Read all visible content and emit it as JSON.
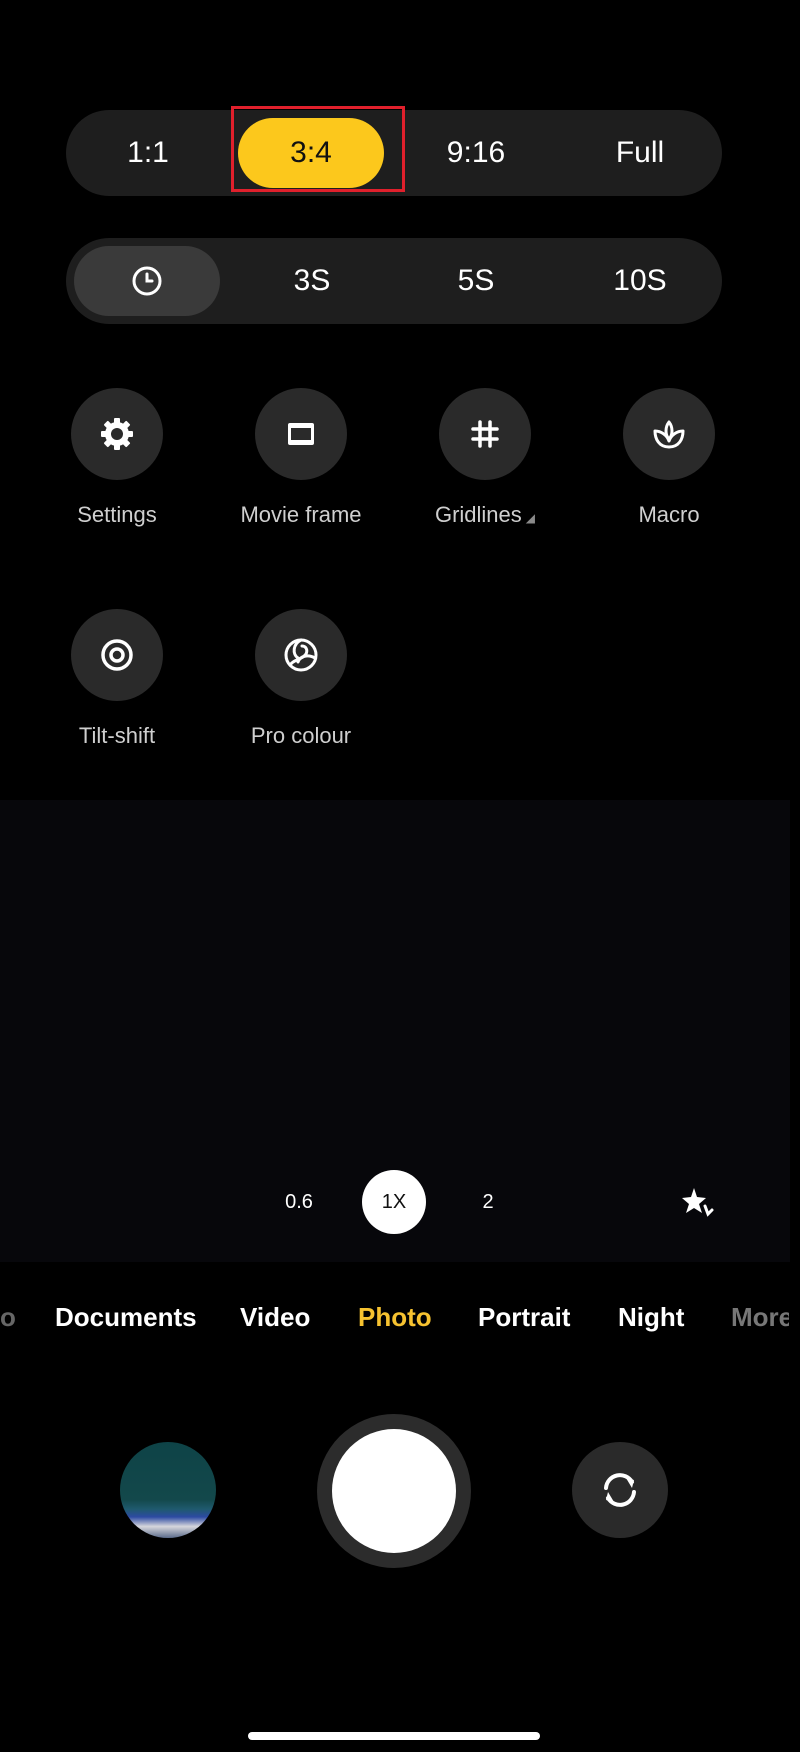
{
  "aspect_ratio": {
    "options": [
      "1:1",
      "3:4",
      "9:16",
      "Full"
    ],
    "selected": "3:4"
  },
  "timer": {
    "options": [
      "clock-icon",
      "3S",
      "5S",
      "10S"
    ],
    "labels": {
      "three": "3S",
      "five": "5S",
      "ten": "10S"
    },
    "selected": "off"
  },
  "tools": [
    {
      "label": "Settings",
      "icon": "gear-icon"
    },
    {
      "label": "Movie frame",
      "icon": "movie-frame-icon"
    },
    {
      "label": "Gridlines",
      "icon": "grid-icon"
    },
    {
      "label": "Macro",
      "icon": "flower-icon"
    },
    {
      "label": "Tilt-shift",
      "icon": "tilt-shift-icon"
    },
    {
      "label": "Pro colour",
      "icon": "pro-colour-icon"
    }
  ],
  "zoom": {
    "levels": [
      "0.6",
      "1X",
      "2"
    ],
    "selected": "1X"
  },
  "modes": {
    "items": [
      "Documents",
      "Video",
      "Photo",
      "Portrait",
      "Night",
      "More"
    ],
    "selected": "Photo"
  },
  "colors": {
    "accent": "#fcc81c",
    "highlight": "#e0202c",
    "mode_active": "#f6c230"
  }
}
